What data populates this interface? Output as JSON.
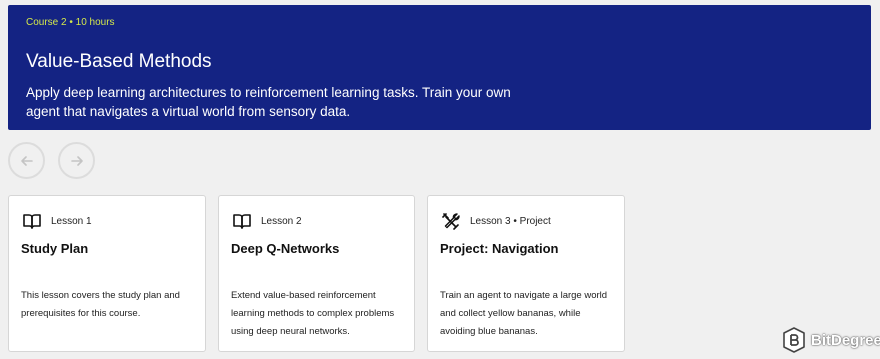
{
  "header": {
    "meta": "Course 2 • 10 hours",
    "title": "Value-Based Methods",
    "description": "Apply deep learning architectures to reinforcement learning tasks. Train your own agent that navigates a virtual world from sensory data."
  },
  "lessons": [
    {
      "label": "Lesson 1",
      "icon": "book-icon",
      "title": "Study Plan",
      "description": "This lesson covers the study plan and prerequisites for this course."
    },
    {
      "label": "Lesson 2",
      "icon": "book-icon",
      "title": "Deep Q-Networks",
      "description": "Extend value-based reinforcement learning methods to complex problems using deep neural networks."
    },
    {
      "label": "Lesson 3 • Project",
      "icon": "tools-icon",
      "title": "Project: Navigation",
      "description": "Train an agent to navigate a large world and collect yellow bananas, while avoiding blue bananas."
    }
  ],
  "watermark": {
    "text": "BitDegree"
  },
  "colors": {
    "banner": "#142383",
    "meta_accent": "#d4e84a"
  }
}
